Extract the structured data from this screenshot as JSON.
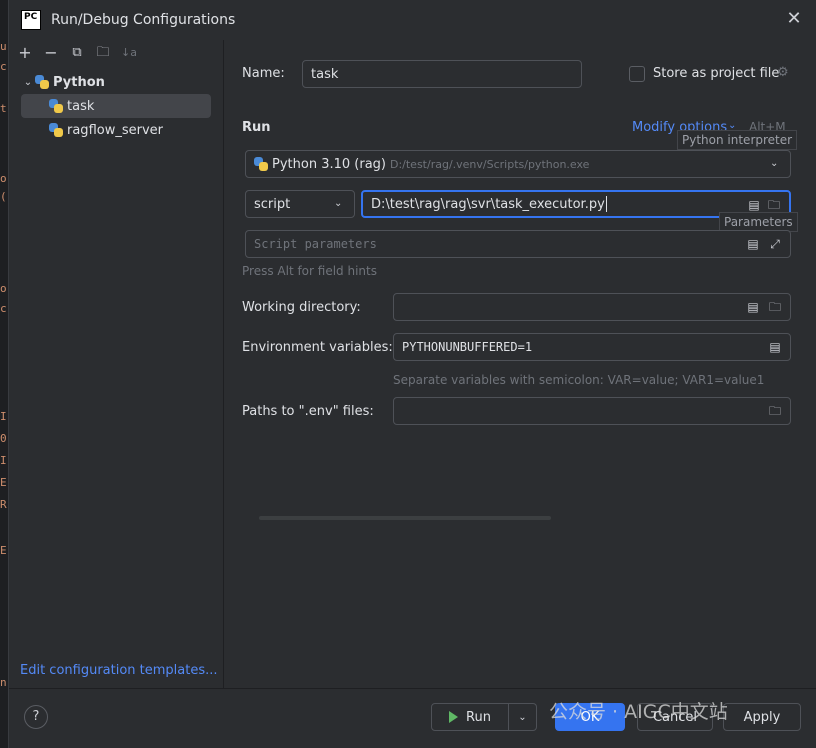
{
  "window": {
    "title": "Run/Debug Configurations",
    "logo_text": "PC"
  },
  "left": {
    "tree": [
      {
        "label": "Python",
        "type": "group"
      },
      {
        "label": "task",
        "type": "item",
        "selected": true
      },
      {
        "label": "ragflow_server",
        "type": "item",
        "selected": false
      }
    ],
    "edit_templates": "Edit configuration templates..."
  },
  "form": {
    "name_label": "Name:",
    "name_value": "task",
    "store_label": "Store as project file",
    "run_section": "Run",
    "modify_options": "Modify options",
    "modify_shortcut": "Alt+M",
    "interpreter_tooltip": "Python interpreter",
    "interpreter_name": "Python 3.10 (rag)",
    "interpreter_path": "D:/test/rag/.venv/Scripts/python.exe",
    "script_mode": "script",
    "script_path": "D:\\test\\rag\\rag\\svr\\task_executor.py",
    "parameters_tooltip": "Parameters",
    "script_params_placeholder": "Script parameters",
    "field_hint": "Press Alt for field hints",
    "working_dir_label": "Working directory:",
    "working_dir_value": "",
    "env_label": "Environment variables:",
    "env_value": "PYTHONUNBUFFERED=1",
    "env_hint": "Separate variables with semicolon: VAR=value; VAR1=value1",
    "env_file_label": "Paths to \".env\" files:",
    "env_file_value": ""
  },
  "bottom": {
    "help": "?",
    "run": "Run",
    "ok": "OK",
    "cancel": "Cancel",
    "apply": "Apply",
    "watermark": "公众号 · AIGC中文站"
  },
  "colors": {
    "accent": "#3574f0",
    "link": "#548af7",
    "run_green": "#5fb865"
  }
}
